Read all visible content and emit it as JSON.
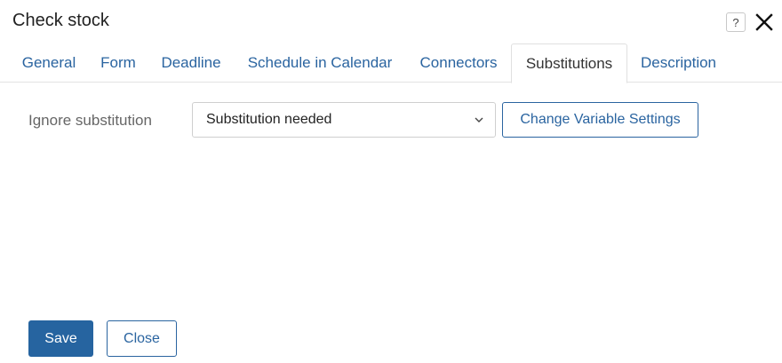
{
  "dialog": {
    "title": "Check stock",
    "help_glyph": "?"
  },
  "tabs": [
    {
      "label": "General"
    },
    {
      "label": "Form"
    },
    {
      "label": "Deadline"
    },
    {
      "label": "Schedule in Calendar"
    },
    {
      "label": "Connectors"
    },
    {
      "label": "Substitutions",
      "active": true
    },
    {
      "label": "Description"
    }
  ],
  "substitutions": {
    "field_label": "Ignore substitution",
    "selected_value": "Substitution needed",
    "change_button_label": "Change Variable Settings"
  },
  "footer": {
    "save_label": "Save",
    "close_label": "Close"
  },
  "colors": {
    "accent": "#2664a0",
    "link": "#2a64a0"
  },
  "icons": [
    "help-icon",
    "close-icon",
    "chevron-down-icon"
  ]
}
